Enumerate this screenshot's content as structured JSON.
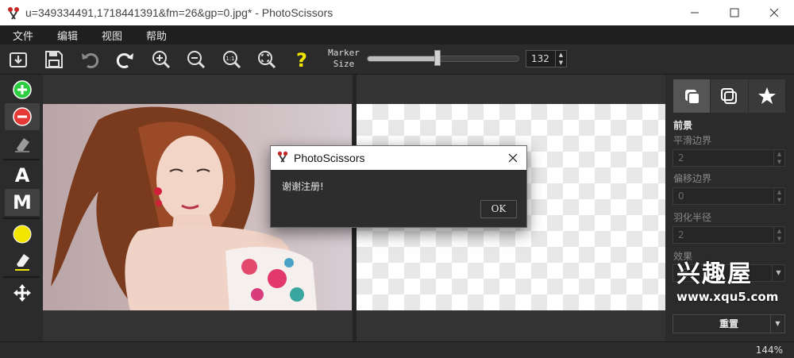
{
  "window": {
    "title": "u=349334491,1718441391&fm=26&gp=0.jpg* - PhotoScissors",
    "app_icon": "scissors-icon",
    "minimize_icon": "minimize-icon",
    "maximize_icon": "maximize-icon",
    "close_icon": "close-icon"
  },
  "menu": [
    "文件",
    "编辑",
    "视图",
    "帮助"
  ],
  "toolbar": {
    "buttons": [
      "open-icon",
      "save-icon",
      "undo-icon",
      "redo-icon",
      "zoom-in-icon",
      "zoom-out-icon",
      "zoom-actual-icon",
      "zoom-fit-icon",
      "help-icon"
    ],
    "marker_label_line1": "Marker",
    "marker_label_line2": "Size",
    "marker_size": "132",
    "marker_fraction": 0.47
  },
  "left_tools": [
    {
      "name": "foreground-marker-icon",
      "selected": false
    },
    {
      "name": "background-marker-icon",
      "selected": true
    },
    {
      "name": "eraser-icon",
      "selected": false
    },
    {
      "name": "auto-mode",
      "label": "A",
      "selected": false
    },
    {
      "name": "manual-mode",
      "label": "M",
      "selected": true
    },
    {
      "name": "color-picker-icon",
      "selected": false
    },
    {
      "name": "eraser-yellow-icon",
      "selected": false
    },
    {
      "name": "move-icon",
      "selected": false
    }
  ],
  "right_panel": {
    "tabs": [
      "foreground-tab-icon",
      "background-tab-icon",
      "effects-tab-icon"
    ],
    "section_title": "前景",
    "smooth_label": "平滑边界",
    "smooth_value": "2",
    "offset_label": "偏移边界",
    "offset_value": "0",
    "feather_label": "羽化半径",
    "feather_value": "2",
    "effect_label": "效果",
    "effect_value": "无",
    "reset_label": "重置"
  },
  "watermark": {
    "line1": "兴趣屋",
    "line2": "www.xqu5.com"
  },
  "status": {
    "zoom": "144%"
  },
  "dialog": {
    "title": "PhotoScissors",
    "message": "谢谢注册!",
    "ok_label": "OK"
  },
  "colors": {
    "accent_green": "#2ecc40",
    "accent_red": "#e53935",
    "accent_yellow": "#f2e600",
    "panel_bg": "#2b2b2b"
  }
}
